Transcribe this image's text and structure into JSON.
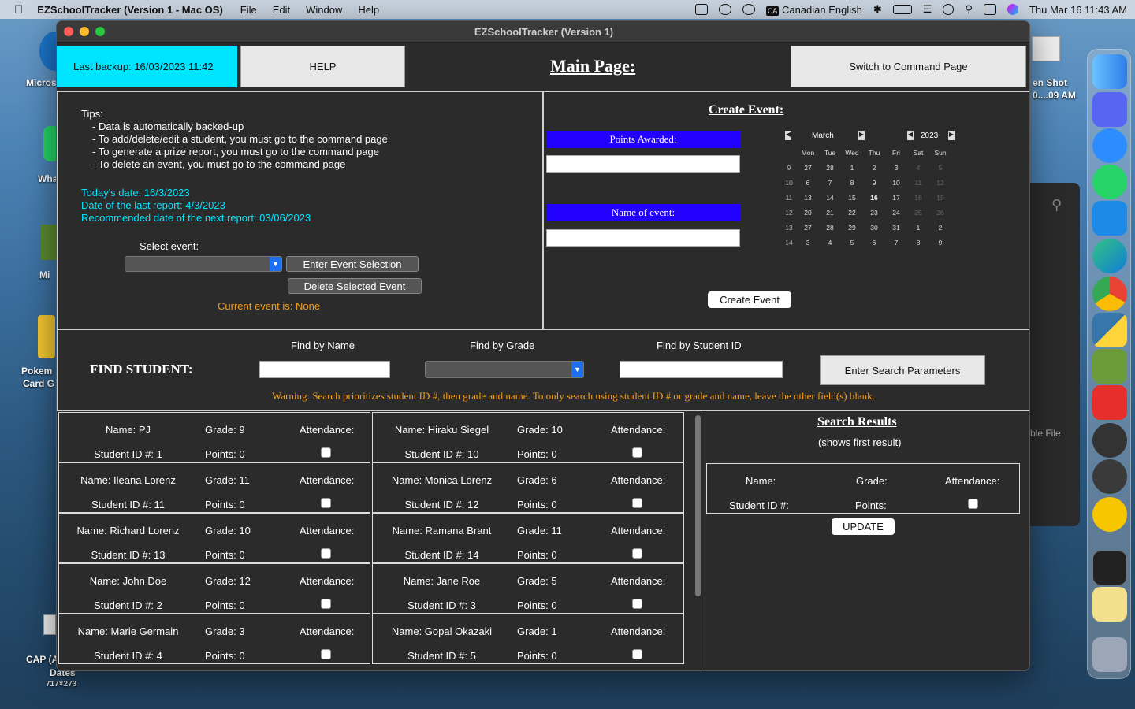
{
  "menubar": {
    "apple": "",
    "app": "EZSchoolTracker (Version 1 - Mac OS)",
    "items": [
      "File",
      "Edit",
      "Window",
      "Help"
    ],
    "input": "Canadian English",
    "input_badge": "CA",
    "datetime": "Thu Mar 16  11:43 AM"
  },
  "desktop": {
    "icons": [
      {
        "label": "Micros"
      },
      {
        "label": "Wha"
      },
      {
        "label": "Mi"
      },
      {
        "label": "Pokem"
      },
      {
        "label": "Card G"
      },
      {
        "label": "CAP (A"
      },
      {
        "label": "Dates"
      },
      {
        "label": "717×273"
      }
    ],
    "screenshot_label": "en Shot",
    "screenshot_sub": "0....09 AM",
    "behind_label": "ble File"
  },
  "window": {
    "title": "EZSchoolTracker (Version 1)"
  },
  "top": {
    "backup": "Last backup: 16/03/2023 11:42",
    "help": "HELP",
    "title": "Main Page:",
    "switch": "Switch to Command Page"
  },
  "tips": {
    "heading": "Tips:",
    "items": [
      "-  Data is automatically backed-up",
      "-  To add/delete/edit a student, you must go to the command page",
      "-  To generate a prize report, you must go to the command page",
      "-  To delete an event, you must go to the command page"
    ],
    "today": "Today's date: 16/3/2023",
    "last_report": "Date of the last report: 4/3/2023",
    "next_report": "Recommended date of the next report: 03/06/2023",
    "select_label": "Select event:",
    "enter_btn": "Enter Event Selection",
    "delete_btn": "Delete Selected Event",
    "current": "Current event is: None"
  },
  "create": {
    "title": "Create Event:",
    "points_label": "Points Awarded:",
    "name_label": "Name of event:",
    "button": "Create Event",
    "calendar": {
      "month": "March",
      "year": "2023",
      "days": [
        "Mon",
        "Tue",
        "Wed",
        "Thu",
        "Fri",
        "Sat",
        "Sun"
      ],
      "weeks": [
        [
          "9",
          "27",
          "28",
          "1",
          "2",
          "3",
          "4",
          "5"
        ],
        [
          "10",
          "6",
          "7",
          "8",
          "9",
          "10",
          "11",
          "12"
        ],
        [
          "11",
          "13",
          "14",
          "15",
          "16",
          "17",
          "18",
          "19"
        ],
        [
          "12",
          "20",
          "21",
          "22",
          "23",
          "24",
          "25",
          "26"
        ],
        [
          "13",
          "27",
          "28",
          "29",
          "30",
          "31",
          "1",
          "2"
        ],
        [
          "14",
          "3",
          "4",
          "5",
          "6",
          "7",
          "8",
          "9"
        ]
      ]
    }
  },
  "find": {
    "title": "FIND STUDENT:",
    "by_name": "Find by Name",
    "by_grade": "Find by Grade",
    "by_id": "Find by Student ID",
    "enter": "Enter Search Parameters",
    "warning": "Warning: Search prioritizes student ID #, then grade and name.  To only search using student ID # or grade and name, leave the other field(s) blank."
  },
  "students": [
    {
      "name": "Name: PJ",
      "grade": "Grade: 9",
      "att": "Attendance:",
      "id": "Student ID #: 1",
      "points": "Points: 0"
    },
    {
      "name": "Name: Hiraku Siegel",
      "grade": "Grade: 10",
      "att": "Attendance:",
      "id": "Student ID #: 10",
      "points": "Points: 0"
    },
    {
      "name": "Name: Ileana Lorenz",
      "grade": "Grade: 11",
      "att": "Attendance:",
      "id": "Student ID #: 11",
      "points": "Points: 0"
    },
    {
      "name": "Name: Monica Lorenz",
      "grade": "Grade: 6",
      "att": "Attendance:",
      "id": "Student ID #: 12",
      "points": "Points: 0"
    },
    {
      "name": "Name: Richard Lorenz",
      "grade": "Grade: 10",
      "att": "Attendance:",
      "id": "Student ID #: 13",
      "points": "Points: 0"
    },
    {
      "name": "Name: Ramana Brant",
      "grade": "Grade: 11",
      "att": "Attendance:",
      "id": "Student ID #: 14",
      "points": "Points: 0"
    },
    {
      "name": "Name: John Doe",
      "grade": "Grade: 12",
      "att": "Attendance:",
      "id": "Student ID #: 2",
      "points": "Points: 0"
    },
    {
      "name": "Name: Jane Roe",
      "grade": "Grade: 5",
      "att": "Attendance:",
      "id": "Student ID #: 3",
      "points": "Points: 0"
    },
    {
      "name": "Name: Marie Germain",
      "grade": "Grade: 3",
      "att": "Attendance:",
      "id": "Student ID #: 4",
      "points": "Points: 0"
    },
    {
      "name": "Name: Gopal Okazaki",
      "grade": "Grade: 1",
      "att": "Attendance:",
      "id": "Student ID #: 5",
      "points": "Points: 0"
    }
  ],
  "results": {
    "title": "Search Results",
    "subtitle": "(shows first result)",
    "name": "Name:",
    "grade": "Grade:",
    "att": "Attendance:",
    "id": "Student ID #:",
    "points": "Points:",
    "update": "UPDATE"
  }
}
